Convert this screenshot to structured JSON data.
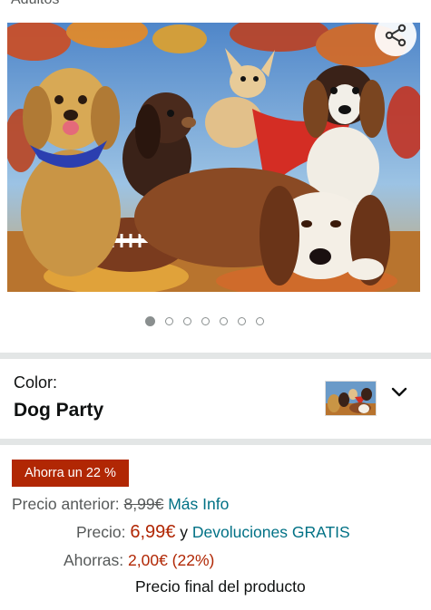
{
  "page": {
    "top_caption": "Adultos"
  },
  "gallery": {
    "image_name": "dog-party-puzzle-image",
    "share_icon": "share-icon",
    "image_count": 7,
    "active_index": 0
  },
  "color_selector": {
    "label": "Color:",
    "value": "Dog Party",
    "dropdown_icon": "chevron-down-icon"
  },
  "pricing": {
    "badge": "Ahorra un 22 %",
    "previous_label": "Precio anterior:",
    "previous_price": "8,99€",
    "more_info_link": "Más Info",
    "price_label": "Precio:",
    "price": "6,99€",
    "connector": "y",
    "returns_link": "Devoluciones GRATIS",
    "savings_label": "Ahorras:",
    "savings": "2,00€ (22%)",
    "final_note": "Precio final del producto"
  },
  "colors": {
    "badge_bg": "#b12704",
    "price_red": "#b12704",
    "link_teal": "#007185",
    "separator": "#e3e6e6",
    "dot": "#8a8f8f"
  }
}
